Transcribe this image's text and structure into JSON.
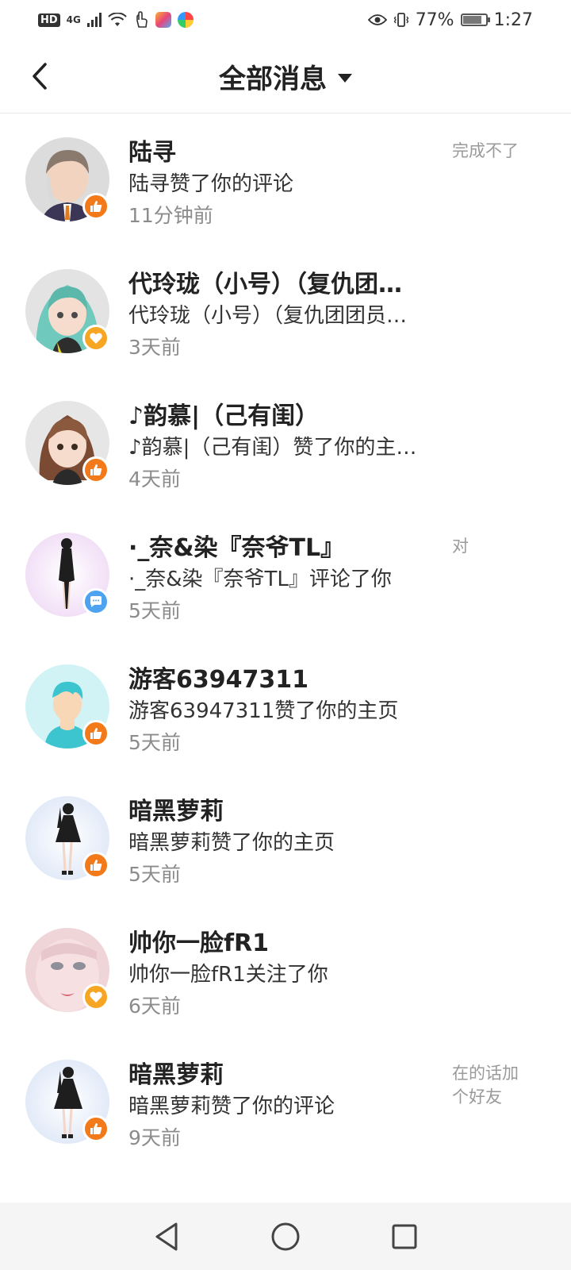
{
  "status_bar": {
    "hd": "HD",
    "network": "4G",
    "battery": "77%",
    "battery_level": 0.77,
    "time": "1:27"
  },
  "header": {
    "title": "全部消息",
    "back_icon": "chevron-left-icon",
    "dropdown_icon": "caret-down-icon"
  },
  "messages": [
    {
      "name": "陆寻",
      "text": "陆寻赞了你的评论",
      "time": "11分钟前",
      "comment": "完成不了",
      "badge": "thumbs-up",
      "badge_color": "#F27A1A"
    },
    {
      "name": "代玲珑（小号）（复仇团…",
      "text": "代玲珑（小号）（复仇团团员…",
      "time": "3天前",
      "comment": "",
      "badge": "heart",
      "badge_color": "#F6A623"
    },
    {
      "name": "♪韵慕|（己有闺）",
      "text": "♪韵慕|（己有闺）赞了你的主…",
      "time": "4天前",
      "comment": "",
      "badge": "thumbs-up",
      "badge_color": "#F27A1A"
    },
    {
      "name": "·_奈&染『奈爷TL』",
      "text": "·_奈&染『奈爷TL』评论了你",
      "time": "5天前",
      "comment": "对",
      "badge": "chat",
      "badge_color": "#4DA3F0"
    },
    {
      "name": "游客63947311",
      "text": "游客63947311赞了你的主页",
      "time": "5天前",
      "comment": "",
      "badge": "thumbs-up",
      "badge_color": "#F27A1A"
    },
    {
      "name": "暗黑萝莉",
      "text": "暗黑萝莉赞了你的主页",
      "time": "5天前",
      "comment": "",
      "badge": "thumbs-up",
      "badge_color": "#F27A1A"
    },
    {
      "name": "帅你一脸fR1",
      "text": "帅你一脸fR1关注了你",
      "time": "6天前",
      "comment": "",
      "badge": "heart",
      "badge_color": "#F6A623"
    },
    {
      "name": "暗黑萝莉",
      "text": "暗黑萝莉赞了你的评论",
      "time": "9天前",
      "comment": "在的话加个好友",
      "badge": "thumbs-up",
      "badge_color": "#F27A1A"
    }
  ],
  "nav": {
    "back_icon": "triangle-back-icon",
    "home_icon": "circle-home-icon",
    "recents_icon": "square-recents-icon"
  }
}
